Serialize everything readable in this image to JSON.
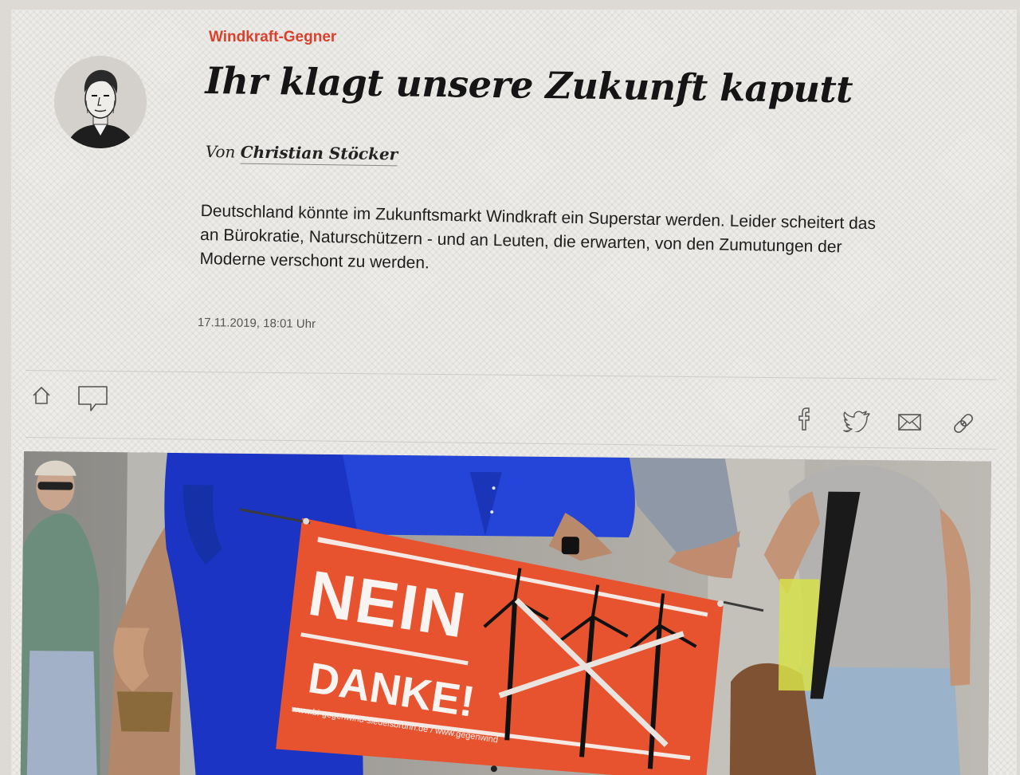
{
  "article": {
    "kicker": "Windkraft-Gegner",
    "headline": "Ihr klagt unsere Zukunft kaputt",
    "byline_prefix": "Von",
    "author": "Christian Stöcker",
    "teaser": "Deutschland könnte im Zukunftsmarkt Windkraft ein Superstar werden. Leider scheitert das an Bürokratie, Naturschützern - und an Leuten, die erwarten, von den Zumutungen der Moderne verschont zu werden.",
    "timestamp": "17.11.2019, 18:01 Uhr"
  },
  "toolbar": {
    "left_icons": [
      "home-icon",
      "comment-icon"
    ],
    "share_icons": [
      "facebook-icon",
      "twitter-icon",
      "mail-icon",
      "link-icon"
    ]
  },
  "hero_image": {
    "sign_line1": "NEIN",
    "sign_line2": "DANKE!",
    "sign_url": "www.bi-gegenwind-siedelsbrunn.de / www.gegenwind"
  },
  "colors": {
    "kicker": "#d8412b",
    "sign_orange": "#e8532f",
    "shirt_blue": "#1d3fd0"
  }
}
